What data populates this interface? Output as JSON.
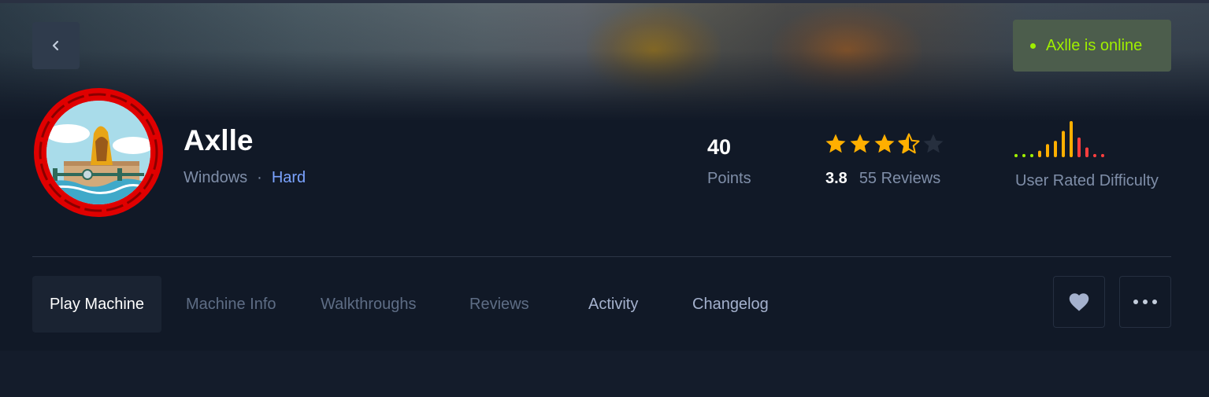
{
  "header": {
    "online_status": "Axlle is online"
  },
  "machine": {
    "name": "Axlle",
    "os": "Windows",
    "separator": "·",
    "difficulty": "Hard"
  },
  "stats": {
    "points_value": "40",
    "points_label": "Points",
    "rating_value": "3.8",
    "rating_stars": 3.5,
    "reviews_label": "55 Reviews",
    "difficulty_label": "User Rated Difficulty",
    "difficulty_votes": [
      1,
      1,
      1,
      2,
      4,
      5,
      8,
      11,
      6,
      3,
      1,
      1
    ],
    "difficulty_colors": [
      "#9fef00",
      "#9fef00",
      "#9fef00",
      "#ffaf00",
      "#ffaf00",
      "#ffaf00",
      "#ffaf00",
      "#ffaf00",
      "#ff3e3e",
      "#ff3e3e",
      "#ff3e3e",
      "#ff3e3e"
    ]
  },
  "tabs": [
    {
      "label": "Play Machine"
    },
    {
      "label": "Machine Info"
    },
    {
      "label": "Walkthroughs"
    },
    {
      "label": "Reviews"
    },
    {
      "label": "Activity"
    },
    {
      "label": "Changelog"
    }
  ],
  "icons": {
    "back": "chevron-left-icon",
    "favorite": "heart-icon",
    "more": "more-horizontal-icon"
  },
  "colors": {
    "accent_green": "#9fef00",
    "hard": "#7ba3ff",
    "star": "#ffaf00",
    "avatar_ring": "#ff0000"
  }
}
